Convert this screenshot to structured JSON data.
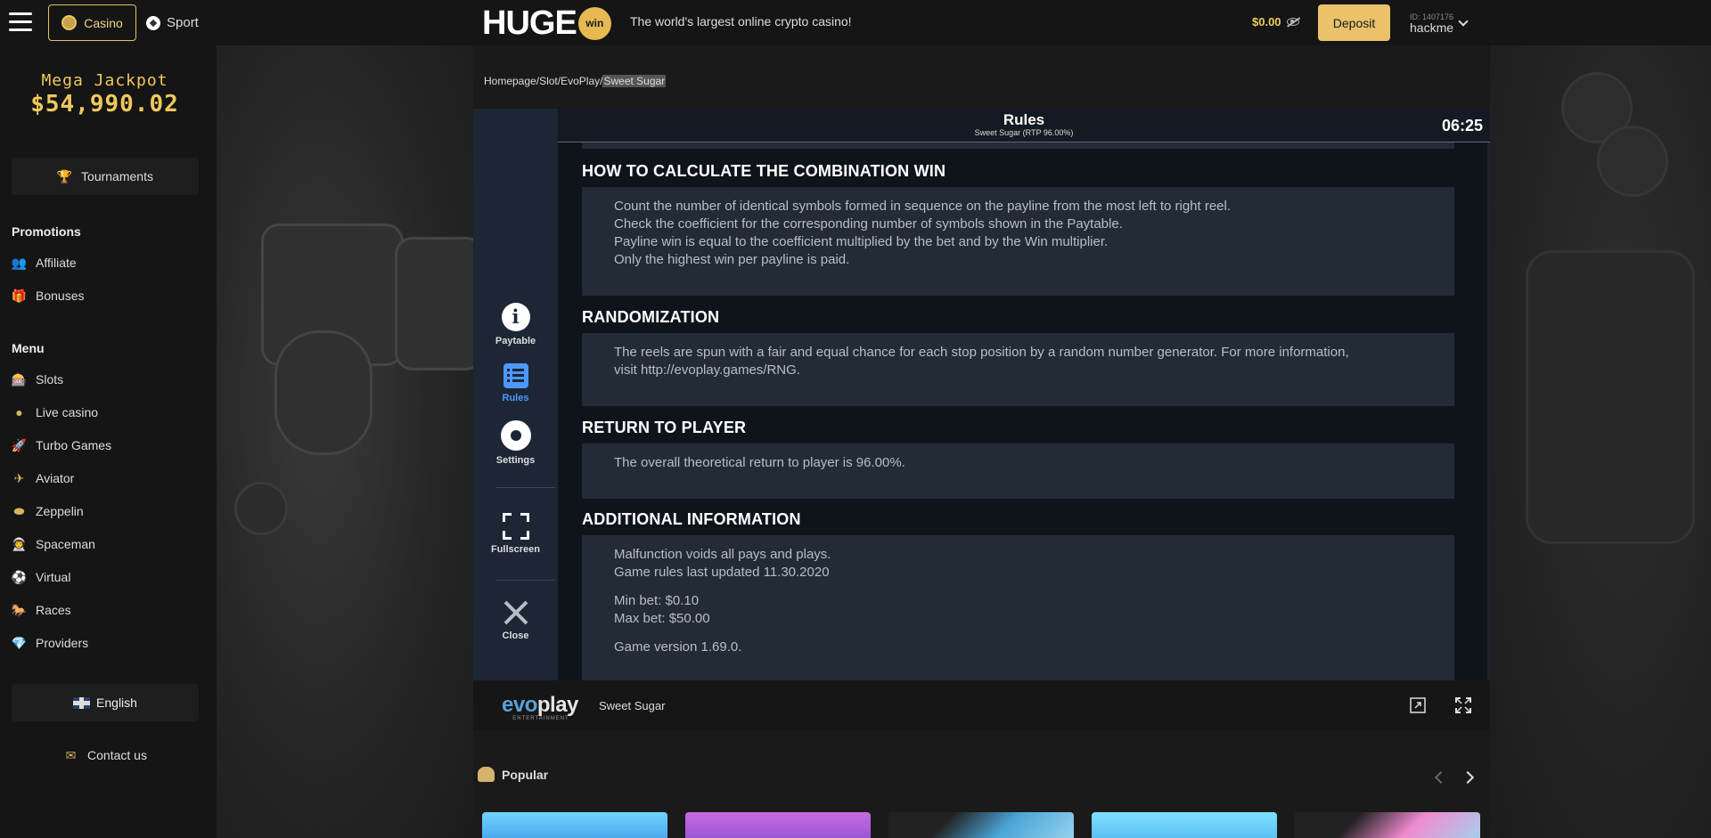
{
  "header": {
    "casino_label": "Casino",
    "sport_label": "Sport",
    "logo_text": "HUGE",
    "logo_badge": "win",
    "tagline": "The world's largest online crypto casino!",
    "balance": "$0.00",
    "deposit_label": "Deposit",
    "user_id": "ID: 1407176",
    "username": "hackme"
  },
  "sidebar": {
    "jackpot_title": "Mega Jackpot",
    "jackpot_value": "$54,990.02",
    "tournaments_label": "Tournaments",
    "promotions_title": "Promotions",
    "promotions": [
      {
        "label": "Affiliate",
        "icon": "people-icon"
      },
      {
        "label": "Bonuses",
        "icon": "gift-icon"
      }
    ],
    "menu_title": "Menu",
    "menu": [
      {
        "label": "Slots",
        "icon": "slot-machine-icon"
      },
      {
        "label": "Live casino",
        "icon": "chip-icon"
      },
      {
        "label": "Turbo Games",
        "icon": "rocket-icon"
      },
      {
        "label": "Aviator",
        "icon": "plane-icon"
      },
      {
        "label": "Zeppelin",
        "icon": "zeppelin-icon"
      },
      {
        "label": "Spaceman",
        "icon": "spaceman-icon"
      },
      {
        "label": "Virtual",
        "icon": "ball-icon"
      },
      {
        "label": "Races",
        "icon": "horse-icon"
      },
      {
        "label": "Providers",
        "icon": "diamond-icon"
      }
    ],
    "language_label": "English",
    "contact_label": "Contact us"
  },
  "breadcrumb": [
    "Homepage",
    "Slot",
    "EvoPlay",
    "Sweet Sugar"
  ],
  "game": {
    "rules_title": "Rules",
    "rules_subtitle": "Sweet Sugar (RTP 96.00%)",
    "clock": "06:25",
    "nav": [
      {
        "label": "Paytable",
        "icon": "info-icon"
      },
      {
        "label": "Rules",
        "icon": "list-icon"
      },
      {
        "label": "Settings",
        "icon": "gear-icon"
      },
      {
        "label": "Fullscreen",
        "icon": "fullscreen-icon"
      },
      {
        "label": "Close",
        "icon": "close-icon"
      }
    ],
    "sections": [
      {
        "title": "HOW TO CALCULATE THE COMBINATION WIN",
        "lines": [
          "Count the number of identical symbols formed in sequence on the payline from the most left to right reel.",
          "Check the coefficient for the corresponding number of symbols shown in the Paytable.",
          "Payline win is equal to the coefficient multiplied by the bet and by the Win multiplier.",
          "Only the highest win per payline is paid."
        ]
      },
      {
        "title": "RANDOMIZATION",
        "lines": [
          "The reels are spun with a fair and equal chance for each stop position by a random number generator. For more information,",
          "visit http://evoplay.games/RNG."
        ]
      },
      {
        "title": "RETURN TO PLAYER",
        "lines": [
          "The overall theoretical return to player is 96.00%."
        ]
      },
      {
        "title": "ADDITIONAL INFORMATION",
        "lines": [
          "Malfunction voids all pays and plays.",
          "Game rules last updated 11.30.2020",
          "",
          "Min bet: $0.10",
          "Max bet: $50.00",
          "",
          "Game version 1.69.0."
        ]
      }
    ]
  },
  "footer": {
    "provider_evo": "evo",
    "provider_play": "play",
    "provider_sub": "ENTERTAINMENT",
    "game_name": "Sweet Sugar"
  },
  "popular_label": "Popular",
  "colors": {
    "accent": "#e9c26a",
    "rules_active": "#4d97ff"
  }
}
